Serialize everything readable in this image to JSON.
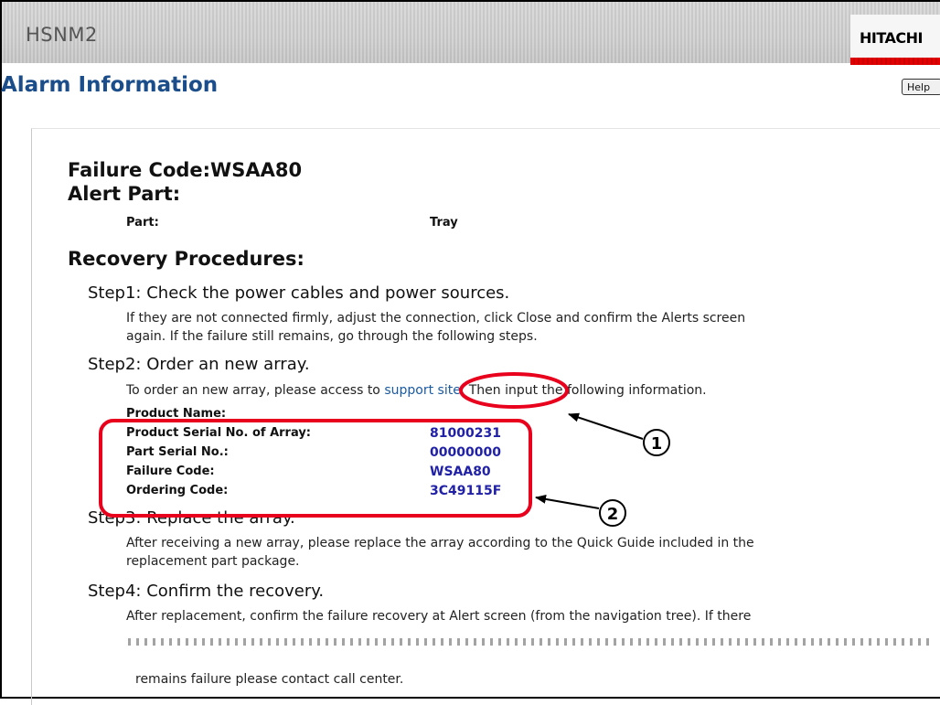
{
  "app": {
    "name": "HSNM2",
    "logo": "HITACHI"
  },
  "page": {
    "title": "Alarm Information",
    "help_label": "Help"
  },
  "failure": {
    "code_line": "Failure Code:WSAA80",
    "alert_heading": "Alert Part:",
    "part_label": "Part:",
    "part_value": "Tray"
  },
  "recovery": {
    "heading": "Recovery Procedures:",
    "step1": {
      "title": "Step1: Check the power cables and power sources.",
      "line1": "If they are not connected firmly, adjust the connection, click Close and confirm the Alerts screen",
      "line2": "again. If the failure still remains, go through the following steps."
    },
    "step2": {
      "title": "Step2: Order an new array.",
      "before_link": "To order an new array, please access to",
      "link": "support site.",
      "after_link": "Then input the following information.",
      "fields": [
        {
          "label": "Product Name:",
          "value": ""
        },
        {
          "label": "Product Serial No. of Array:",
          "value": "81000231"
        },
        {
          "label": "Part Serial No.:",
          "value": "00000000"
        },
        {
          "label": "Failure Code:",
          "value": "WSAA80"
        },
        {
          "label": "Ordering Code:",
          "value": "3C49115F"
        }
      ]
    },
    "step3": {
      "title": "Step3: Replace the array.",
      "line1": "After receiving a new array, please replace the array according to the Quick Guide included in the",
      "line2": "replacement part package."
    },
    "step4": {
      "title": "Step4: Confirm the recovery.",
      "line1": "After replacement, confirm the failure recovery at Alert screen (from the navigation tree). If there",
      "line2": "remains failure please contact call center."
    }
  },
  "callouts": {
    "one": "1",
    "two": "2"
  },
  "colors": {
    "highlight": "#e8001c",
    "title_blue": "#1a4d8a",
    "value_blue": "#2121a8"
  }
}
